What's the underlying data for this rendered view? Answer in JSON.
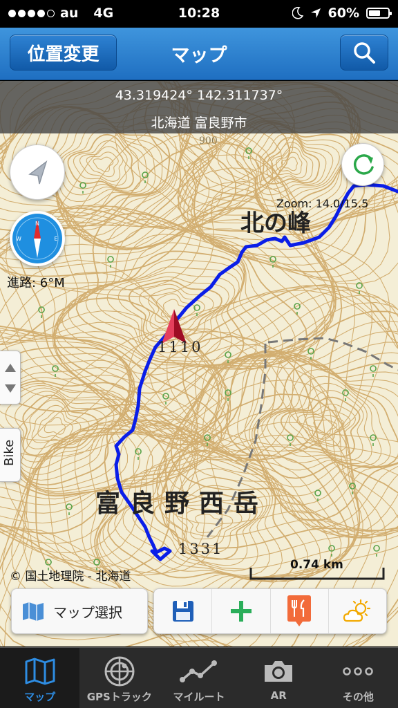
{
  "status_bar": {
    "carrier": "au",
    "network": "4G",
    "time": "10:28",
    "battery": "60%",
    "battery_level": 0.6
  },
  "nav": {
    "left_button": "位置変更",
    "title": "マップ",
    "search_icon": "search-icon"
  },
  "map_info": {
    "coordinates": "43.319424° 142.311737°",
    "place": "北海道 富良野市"
  },
  "map": {
    "zoom": "Zoom: 14.0/15.5",
    "heading": "進路: 6°M",
    "side_tab": "Bike",
    "credit": "© 国土地理院 - 北海道",
    "scale": "0.74 km",
    "labels": {
      "peak_north": "北の峰",
      "mountain_name": "富良野西岳",
      "elev_1": "1110",
      "elev_2": "1331",
      "elev_3": "900"
    },
    "track_color": "#0a1ee8",
    "marker_color": "#c8102e",
    "contour_color": "#c9a35c"
  },
  "toolbar": {
    "map_select": "マップ選択",
    "icons": [
      "save-icon",
      "add-icon",
      "restaurant-icon",
      "weather-icon"
    ]
  },
  "tabs": [
    {
      "label": "マップ",
      "icon": "map-icon",
      "active": true
    },
    {
      "label": "GPSトラック",
      "icon": "radar-icon",
      "active": false
    },
    {
      "label": "マイルート",
      "icon": "route-icon",
      "active": false
    },
    {
      "label": "AR",
      "icon": "camera-icon",
      "active": false
    },
    {
      "label": "その他",
      "icon": "more-icon",
      "active": false
    }
  ],
  "colors": {
    "nav_blue": "#2a7bcf",
    "tab_active": "#2e8de3"
  }
}
